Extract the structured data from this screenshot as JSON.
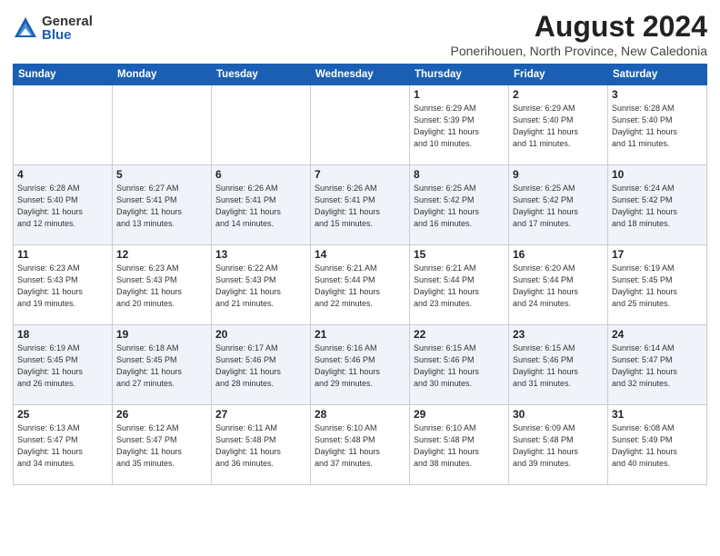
{
  "logo": {
    "general": "General",
    "blue": "Blue"
  },
  "title": "August 2024",
  "location": "Ponerihouen, North Province, New Caledonia",
  "weekdays": [
    "Sunday",
    "Monday",
    "Tuesday",
    "Wednesday",
    "Thursday",
    "Friday",
    "Saturday"
  ],
  "weeks": [
    [
      {
        "day": "",
        "info": ""
      },
      {
        "day": "",
        "info": ""
      },
      {
        "day": "",
        "info": ""
      },
      {
        "day": "",
        "info": ""
      },
      {
        "day": "1",
        "info": "Sunrise: 6:29 AM\nSunset: 5:39 PM\nDaylight: 11 hours\nand 10 minutes."
      },
      {
        "day": "2",
        "info": "Sunrise: 6:29 AM\nSunset: 5:40 PM\nDaylight: 11 hours\nand 11 minutes."
      },
      {
        "day": "3",
        "info": "Sunrise: 6:28 AM\nSunset: 5:40 PM\nDaylight: 11 hours\nand 11 minutes."
      }
    ],
    [
      {
        "day": "4",
        "info": "Sunrise: 6:28 AM\nSunset: 5:40 PM\nDaylight: 11 hours\nand 12 minutes."
      },
      {
        "day": "5",
        "info": "Sunrise: 6:27 AM\nSunset: 5:41 PM\nDaylight: 11 hours\nand 13 minutes."
      },
      {
        "day": "6",
        "info": "Sunrise: 6:26 AM\nSunset: 5:41 PM\nDaylight: 11 hours\nand 14 minutes."
      },
      {
        "day": "7",
        "info": "Sunrise: 6:26 AM\nSunset: 5:41 PM\nDaylight: 11 hours\nand 15 minutes."
      },
      {
        "day": "8",
        "info": "Sunrise: 6:25 AM\nSunset: 5:42 PM\nDaylight: 11 hours\nand 16 minutes."
      },
      {
        "day": "9",
        "info": "Sunrise: 6:25 AM\nSunset: 5:42 PM\nDaylight: 11 hours\nand 17 minutes."
      },
      {
        "day": "10",
        "info": "Sunrise: 6:24 AM\nSunset: 5:42 PM\nDaylight: 11 hours\nand 18 minutes."
      }
    ],
    [
      {
        "day": "11",
        "info": "Sunrise: 6:23 AM\nSunset: 5:43 PM\nDaylight: 11 hours\nand 19 minutes."
      },
      {
        "day": "12",
        "info": "Sunrise: 6:23 AM\nSunset: 5:43 PM\nDaylight: 11 hours\nand 20 minutes."
      },
      {
        "day": "13",
        "info": "Sunrise: 6:22 AM\nSunset: 5:43 PM\nDaylight: 11 hours\nand 21 minutes."
      },
      {
        "day": "14",
        "info": "Sunrise: 6:21 AM\nSunset: 5:44 PM\nDaylight: 11 hours\nand 22 minutes."
      },
      {
        "day": "15",
        "info": "Sunrise: 6:21 AM\nSunset: 5:44 PM\nDaylight: 11 hours\nand 23 minutes."
      },
      {
        "day": "16",
        "info": "Sunrise: 6:20 AM\nSunset: 5:44 PM\nDaylight: 11 hours\nand 24 minutes."
      },
      {
        "day": "17",
        "info": "Sunrise: 6:19 AM\nSunset: 5:45 PM\nDaylight: 11 hours\nand 25 minutes."
      }
    ],
    [
      {
        "day": "18",
        "info": "Sunrise: 6:19 AM\nSunset: 5:45 PM\nDaylight: 11 hours\nand 26 minutes."
      },
      {
        "day": "19",
        "info": "Sunrise: 6:18 AM\nSunset: 5:45 PM\nDaylight: 11 hours\nand 27 minutes."
      },
      {
        "day": "20",
        "info": "Sunrise: 6:17 AM\nSunset: 5:46 PM\nDaylight: 11 hours\nand 28 minutes."
      },
      {
        "day": "21",
        "info": "Sunrise: 6:16 AM\nSunset: 5:46 PM\nDaylight: 11 hours\nand 29 minutes."
      },
      {
        "day": "22",
        "info": "Sunrise: 6:15 AM\nSunset: 5:46 PM\nDaylight: 11 hours\nand 30 minutes."
      },
      {
        "day": "23",
        "info": "Sunrise: 6:15 AM\nSunset: 5:46 PM\nDaylight: 11 hours\nand 31 minutes."
      },
      {
        "day": "24",
        "info": "Sunrise: 6:14 AM\nSunset: 5:47 PM\nDaylight: 11 hours\nand 32 minutes."
      }
    ],
    [
      {
        "day": "25",
        "info": "Sunrise: 6:13 AM\nSunset: 5:47 PM\nDaylight: 11 hours\nand 34 minutes."
      },
      {
        "day": "26",
        "info": "Sunrise: 6:12 AM\nSunset: 5:47 PM\nDaylight: 11 hours\nand 35 minutes."
      },
      {
        "day": "27",
        "info": "Sunrise: 6:11 AM\nSunset: 5:48 PM\nDaylight: 11 hours\nand 36 minutes."
      },
      {
        "day": "28",
        "info": "Sunrise: 6:10 AM\nSunset: 5:48 PM\nDaylight: 11 hours\nand 37 minutes."
      },
      {
        "day": "29",
        "info": "Sunrise: 6:10 AM\nSunset: 5:48 PM\nDaylight: 11 hours\nand 38 minutes."
      },
      {
        "day": "30",
        "info": "Sunrise: 6:09 AM\nSunset: 5:48 PM\nDaylight: 11 hours\nand 39 minutes."
      },
      {
        "day": "31",
        "info": "Sunrise: 6:08 AM\nSunset: 5:49 PM\nDaylight: 11 hours\nand 40 minutes."
      }
    ]
  ]
}
